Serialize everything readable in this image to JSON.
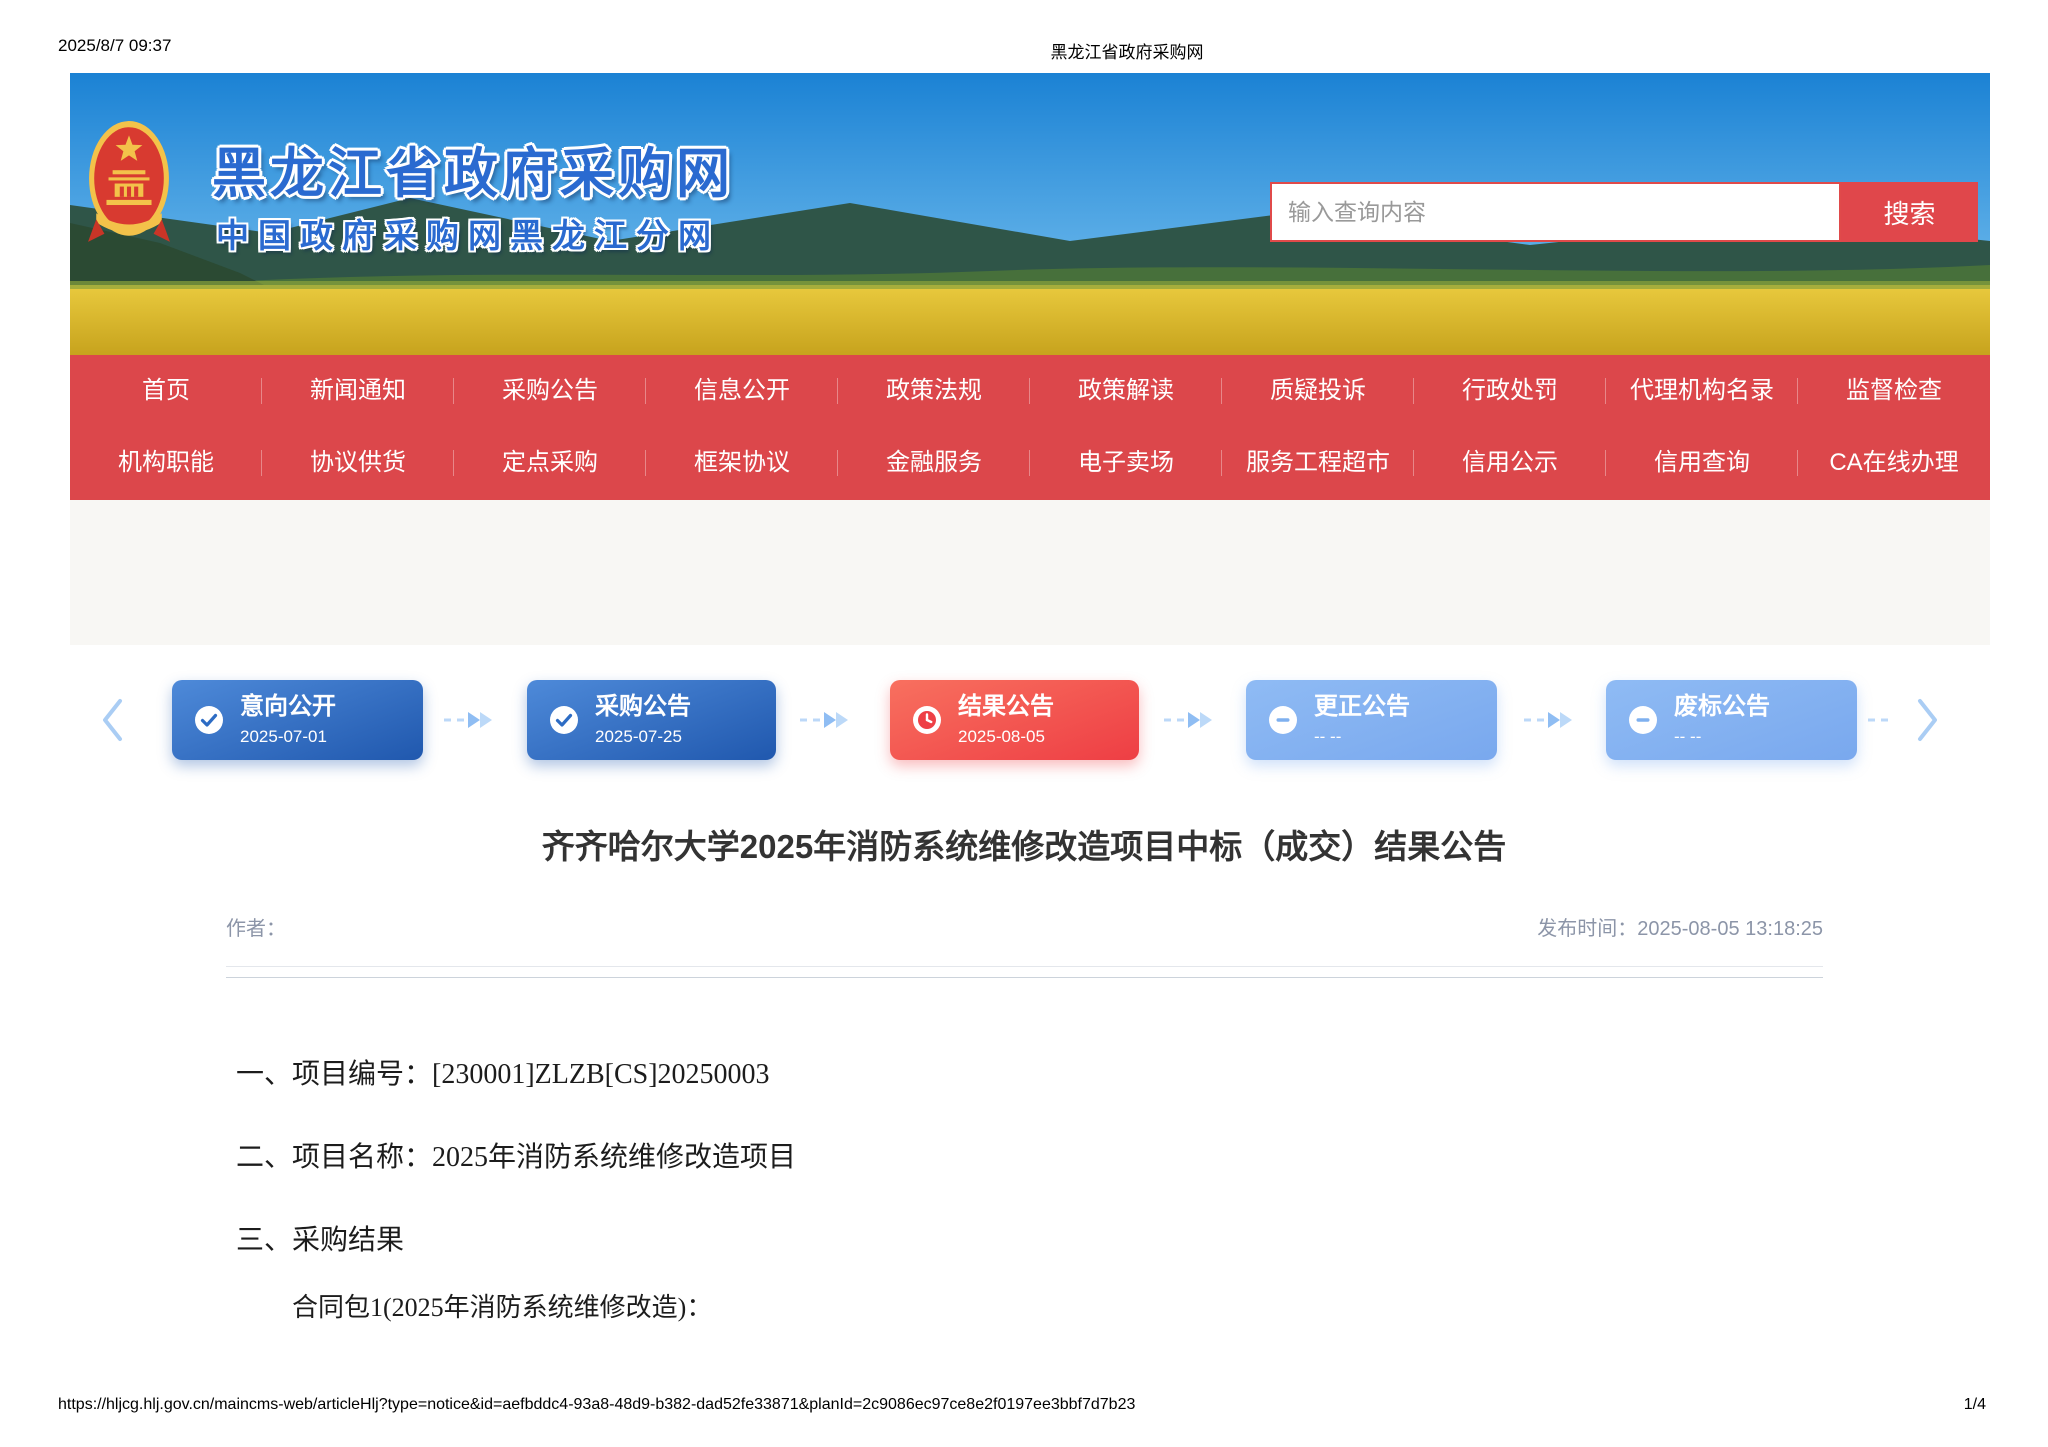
{
  "print_header": {
    "datetime": "2025/8/7 09:37",
    "title": "黑龙江省政府采购网"
  },
  "footer": {
    "url": "https://hljcg.hlj.gov.cn/maincms-web/articleHlj?type=notice&id=aefbddc4-93a8-48d9-b382-dad52fe33871&planId=2c9086ec97ce8e2f0197ee3bbf7d7b23",
    "page": "1/4"
  },
  "banner": {
    "site_title": "黑龙江省政府采购网",
    "site_subtitle": "中国政府采购网黑龙江分网",
    "search": {
      "placeholder": "输入查询内容",
      "button": "搜索"
    }
  },
  "nav": {
    "row1": [
      "首页",
      "新闻通知",
      "采购公告",
      "信息公开",
      "政策法规",
      "政策解读",
      "质疑投诉",
      "行政处罚",
      "代理机构名录",
      "监督检查"
    ],
    "row2": [
      "机构职能",
      "协议供货",
      "定点采购",
      "框架协议",
      "金融服务",
      "电子卖场",
      "服务工程超市",
      "信用公示",
      "信用查询",
      "CA在线办理"
    ]
  },
  "timeline": {
    "steps": [
      {
        "label": "意向公开",
        "date": "2025-07-01",
        "icon": "check",
        "state": "done"
      },
      {
        "label": "采购公告",
        "date": "2025-07-25",
        "icon": "check",
        "state": "done"
      },
      {
        "label": "结果公告",
        "date": "2025-08-05",
        "icon": "clock",
        "state": "current"
      },
      {
        "label": "更正公告",
        "date": "-- --",
        "icon": "minus",
        "state": "empty"
      },
      {
        "label": "废标公告",
        "date": "-- --",
        "icon": "minus",
        "state": "empty"
      }
    ]
  },
  "article": {
    "title": "齐齐哈尔大学2025年消防系统维修改造项目中标（成交）结果公告",
    "author_label": "作者：",
    "publish_label": "发布时间：",
    "publish_time": "2025-08-05 13:18:25",
    "paragraphs": [
      "一、项目编号：[230001]ZLZB[CS]20250003",
      "二、项目名称：2025年消防系统维修改造项目",
      "三、采购结果",
      "合同包1(2025年消防系统维修改造)："
    ]
  },
  "colors": {
    "nav_red": "#dc474b",
    "search_button_red": "#e0474b",
    "site_title_blue": "#2a6ad0",
    "step_done_blue": "#2058ae",
    "step_current_red": "#ee3e44",
    "step_empty_blue": "#79a8ee",
    "meta_gray": "#8c95a8",
    "subband_gray": "#f8f7f4"
  }
}
